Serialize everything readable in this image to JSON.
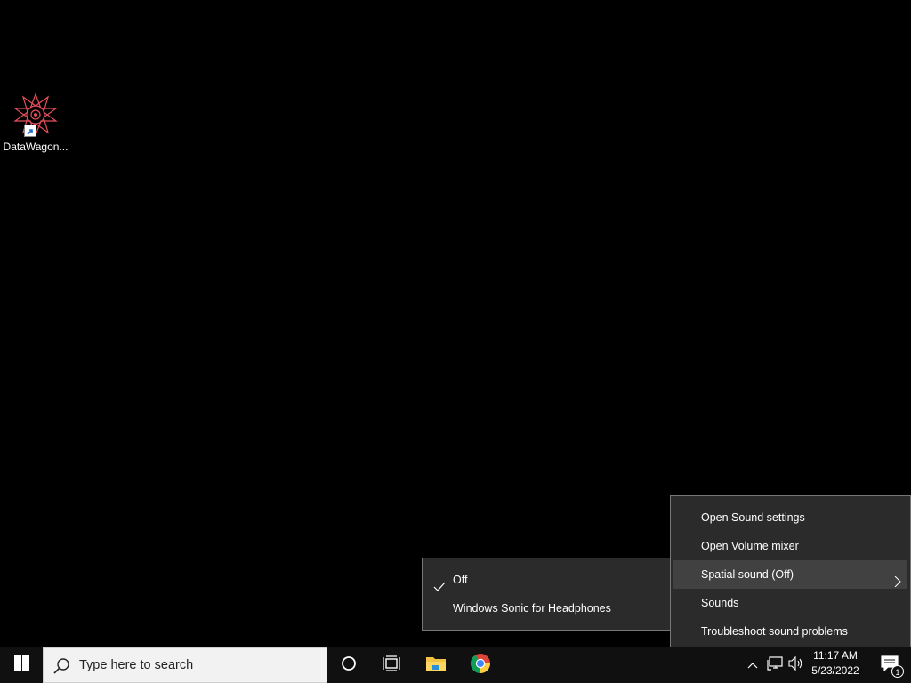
{
  "desktop": {
    "icons": [
      {
        "label": "DataWagon...",
        "icon": "datawagon-app-icon"
      }
    ]
  },
  "sound_menu": {
    "items": [
      {
        "label": "Open Sound settings"
      },
      {
        "label": "Open Volume mixer"
      },
      {
        "label": "Spatial sound (Off)",
        "highlighted": true,
        "has_submenu": true
      },
      {
        "label": "Sounds"
      },
      {
        "label": "Troubleshoot sound problems"
      }
    ]
  },
  "spatial_submenu": {
    "items": [
      {
        "label": "Off",
        "checked": true
      },
      {
        "label": "Windows Sonic for Headphones",
        "checked": false
      }
    ]
  },
  "taskbar": {
    "search_placeholder": "Type here to search",
    "pinned": [
      "cortana-icon",
      "task-view-icon",
      "file-explorer-icon",
      "chrome-icon"
    ],
    "tray": {
      "time": "11:17 AM",
      "date": "5/23/2022",
      "notification_count": "1"
    }
  },
  "colors": {
    "menu_bg": "#2b2b2b",
    "menu_highlight": "#414141",
    "taskbar_bg": "#101010",
    "accent_folder": "#f3c244"
  }
}
